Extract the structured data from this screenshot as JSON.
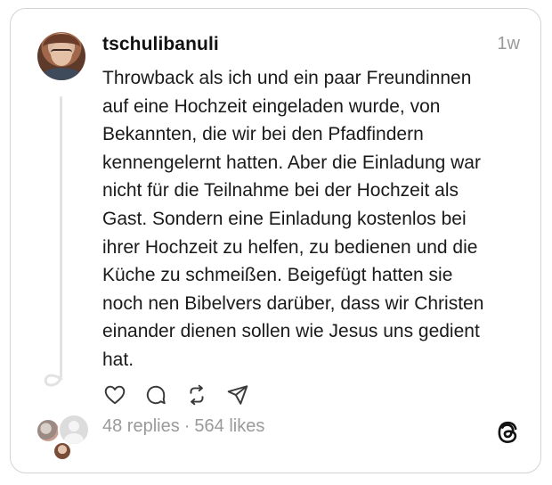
{
  "post": {
    "username": "tschulibanuli",
    "timestamp": "1w",
    "lines": [
      "Throwback als ich und ein paar Freundinnen",
      "auf eine Hochzeit eingeladen wurde, von",
      "Bekannten, die wir bei den Pfadfindern",
      "kennengelernt hatten. Aber die Einladung war",
      "nicht für die Teilnahme bei der Hochzeit als",
      "Gast. Sondern eine Einladung kostenlos bei",
      "ihrer Hochzeit zu helfen, zu bedienen und die",
      "Küche zu schmeißen. Beigefügt hatten sie",
      "noch nen Bibelvers darüber, dass wir Christen",
      "einander dienen sollen wie Jesus uns gedient",
      "hat."
    ]
  },
  "actions": {
    "like_icon": "heart-icon",
    "reply_icon": "comment-icon",
    "repost_icon": "repost-icon",
    "share_icon": "send-icon"
  },
  "stats": {
    "replies": "48 replies",
    "separator": "·",
    "likes": "564 likes"
  },
  "brand": {
    "logo_icon": "threads-logo-icon",
    "text_color": "#1a1a1a",
    "muted_color": "#9a9a9a",
    "border_color": "#d4d4d4"
  }
}
